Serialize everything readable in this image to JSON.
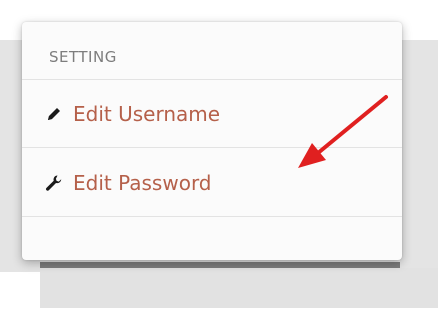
{
  "menu": {
    "header": "SETTING",
    "items": [
      {
        "label": "Edit Username",
        "icon": "pencil-icon"
      },
      {
        "label": "Edit Password",
        "icon": "wrench-icon"
      }
    ]
  },
  "colors": {
    "item_text": "#b5604a",
    "header_text": "#7d7d7d",
    "arrow": "#e02020"
  }
}
